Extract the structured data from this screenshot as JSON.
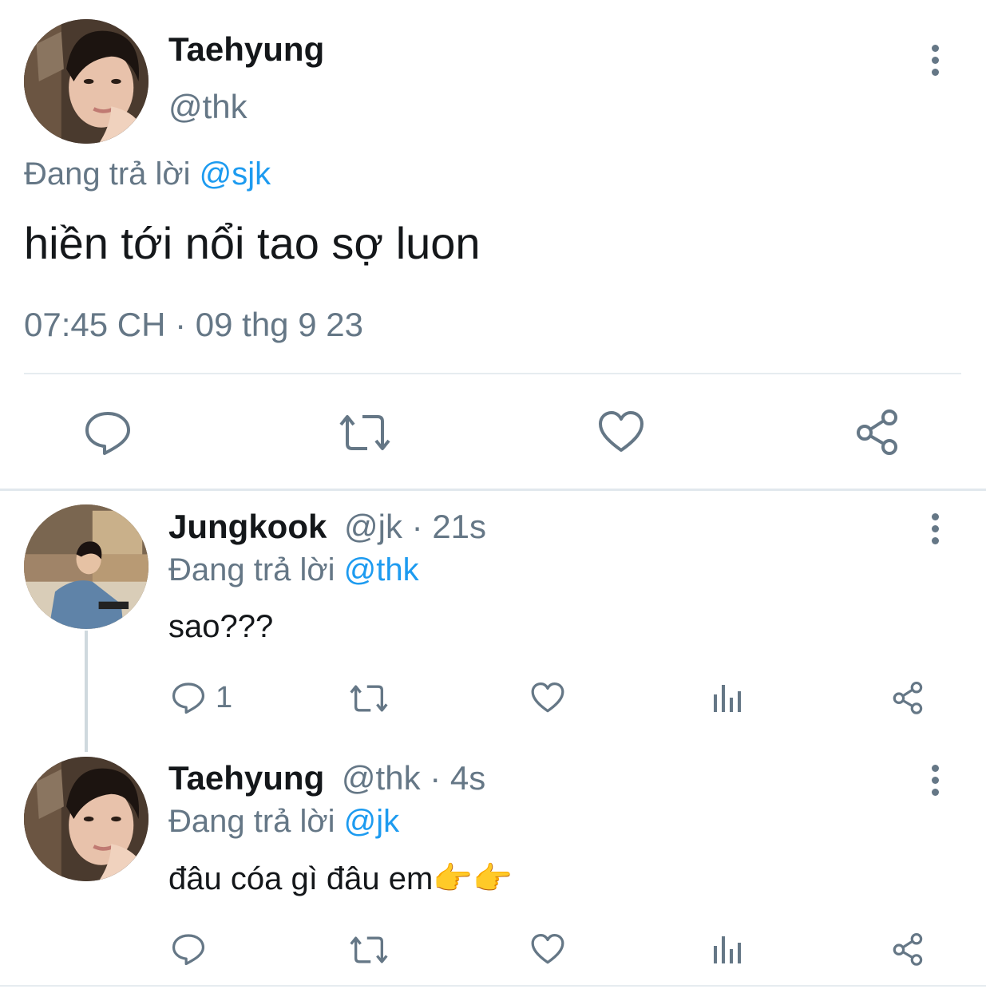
{
  "main_tweet": {
    "author_name": "Taehyung",
    "author_handle": "@thk",
    "reply_prefix": "Đang trả lời",
    "reply_to": "@sjk",
    "text": "hiền tới nổi tao sợ luon",
    "timestamp": "07:45 CH · 09 thg 9 23"
  },
  "replies": [
    {
      "author_name": "Jungkook",
      "meta": "@jk · 21s",
      "reply_prefix": "Đang trả lời",
      "reply_to": "@thk",
      "text": "sao???",
      "reply_count": "1"
    },
    {
      "author_name": "Taehyung",
      "meta": "@thk · 4s",
      "reply_prefix": "Đang trả lời",
      "reply_to": "@jk",
      "text": "đâu cóa gì đâu em",
      "emoji": "👉👉"
    }
  ],
  "icons": {
    "comment": "comment-icon",
    "retweet": "retweet-icon",
    "like": "heart-icon",
    "share": "share-icon",
    "views": "analytics-icon",
    "more": "more-vertical-icon"
  },
  "colors": {
    "link": "#1d9bf0",
    "muted": "#657786",
    "text": "#14171a",
    "divider": "#e6ecf0"
  }
}
